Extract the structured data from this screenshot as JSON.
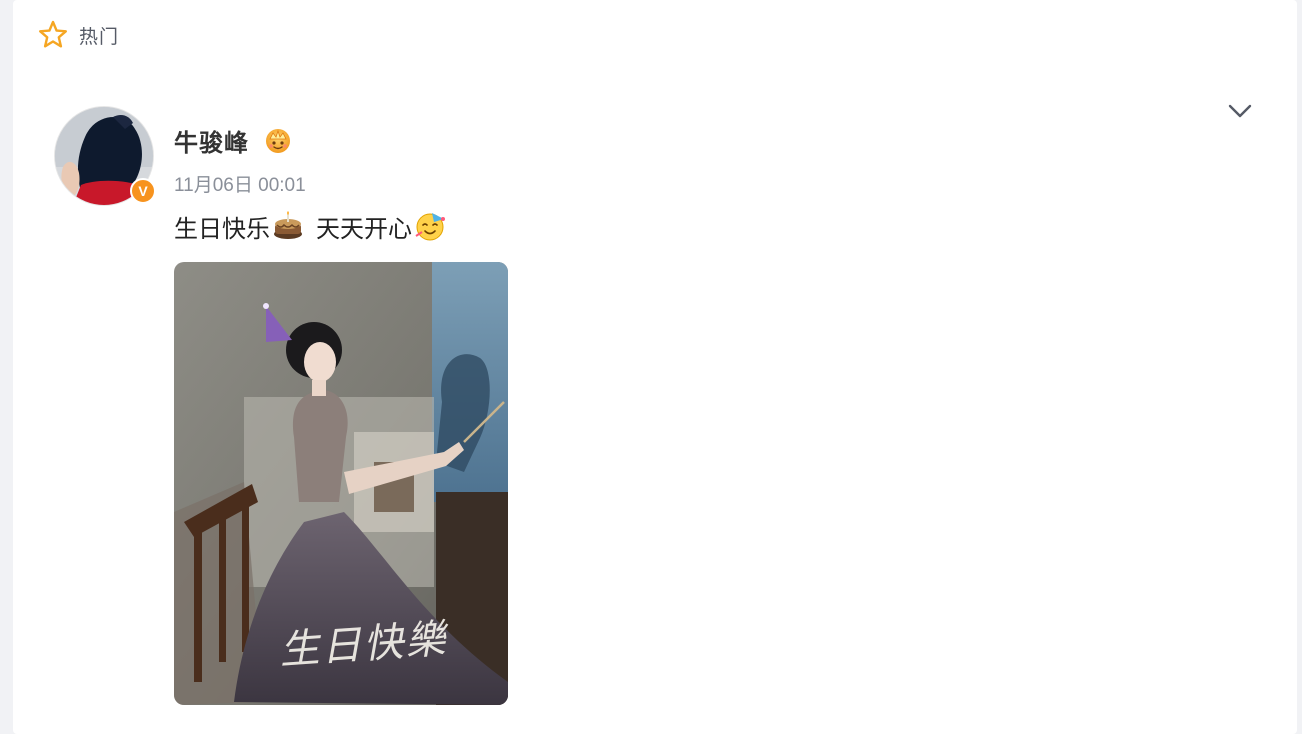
{
  "header": {
    "section_icon": "star-icon",
    "section_label": "热门"
  },
  "post": {
    "author": {
      "name": "牛骏峰",
      "verified_badge": "V",
      "badge_icon": "crown-badge-icon"
    },
    "timestamp": "11月06日 00:01",
    "text_parts": [
      "生日快乐",
      "天天开心"
    ],
    "emojis": [
      "cake-icon",
      "party-face-icon"
    ],
    "image": {
      "caption": "生日快樂"
    },
    "menu_icon": "chevron-down-icon"
  },
  "colors": {
    "accent_star": "#f5a623",
    "verified_badge": "#f7931e",
    "name": "#333333",
    "time": "#8a8f99"
  }
}
